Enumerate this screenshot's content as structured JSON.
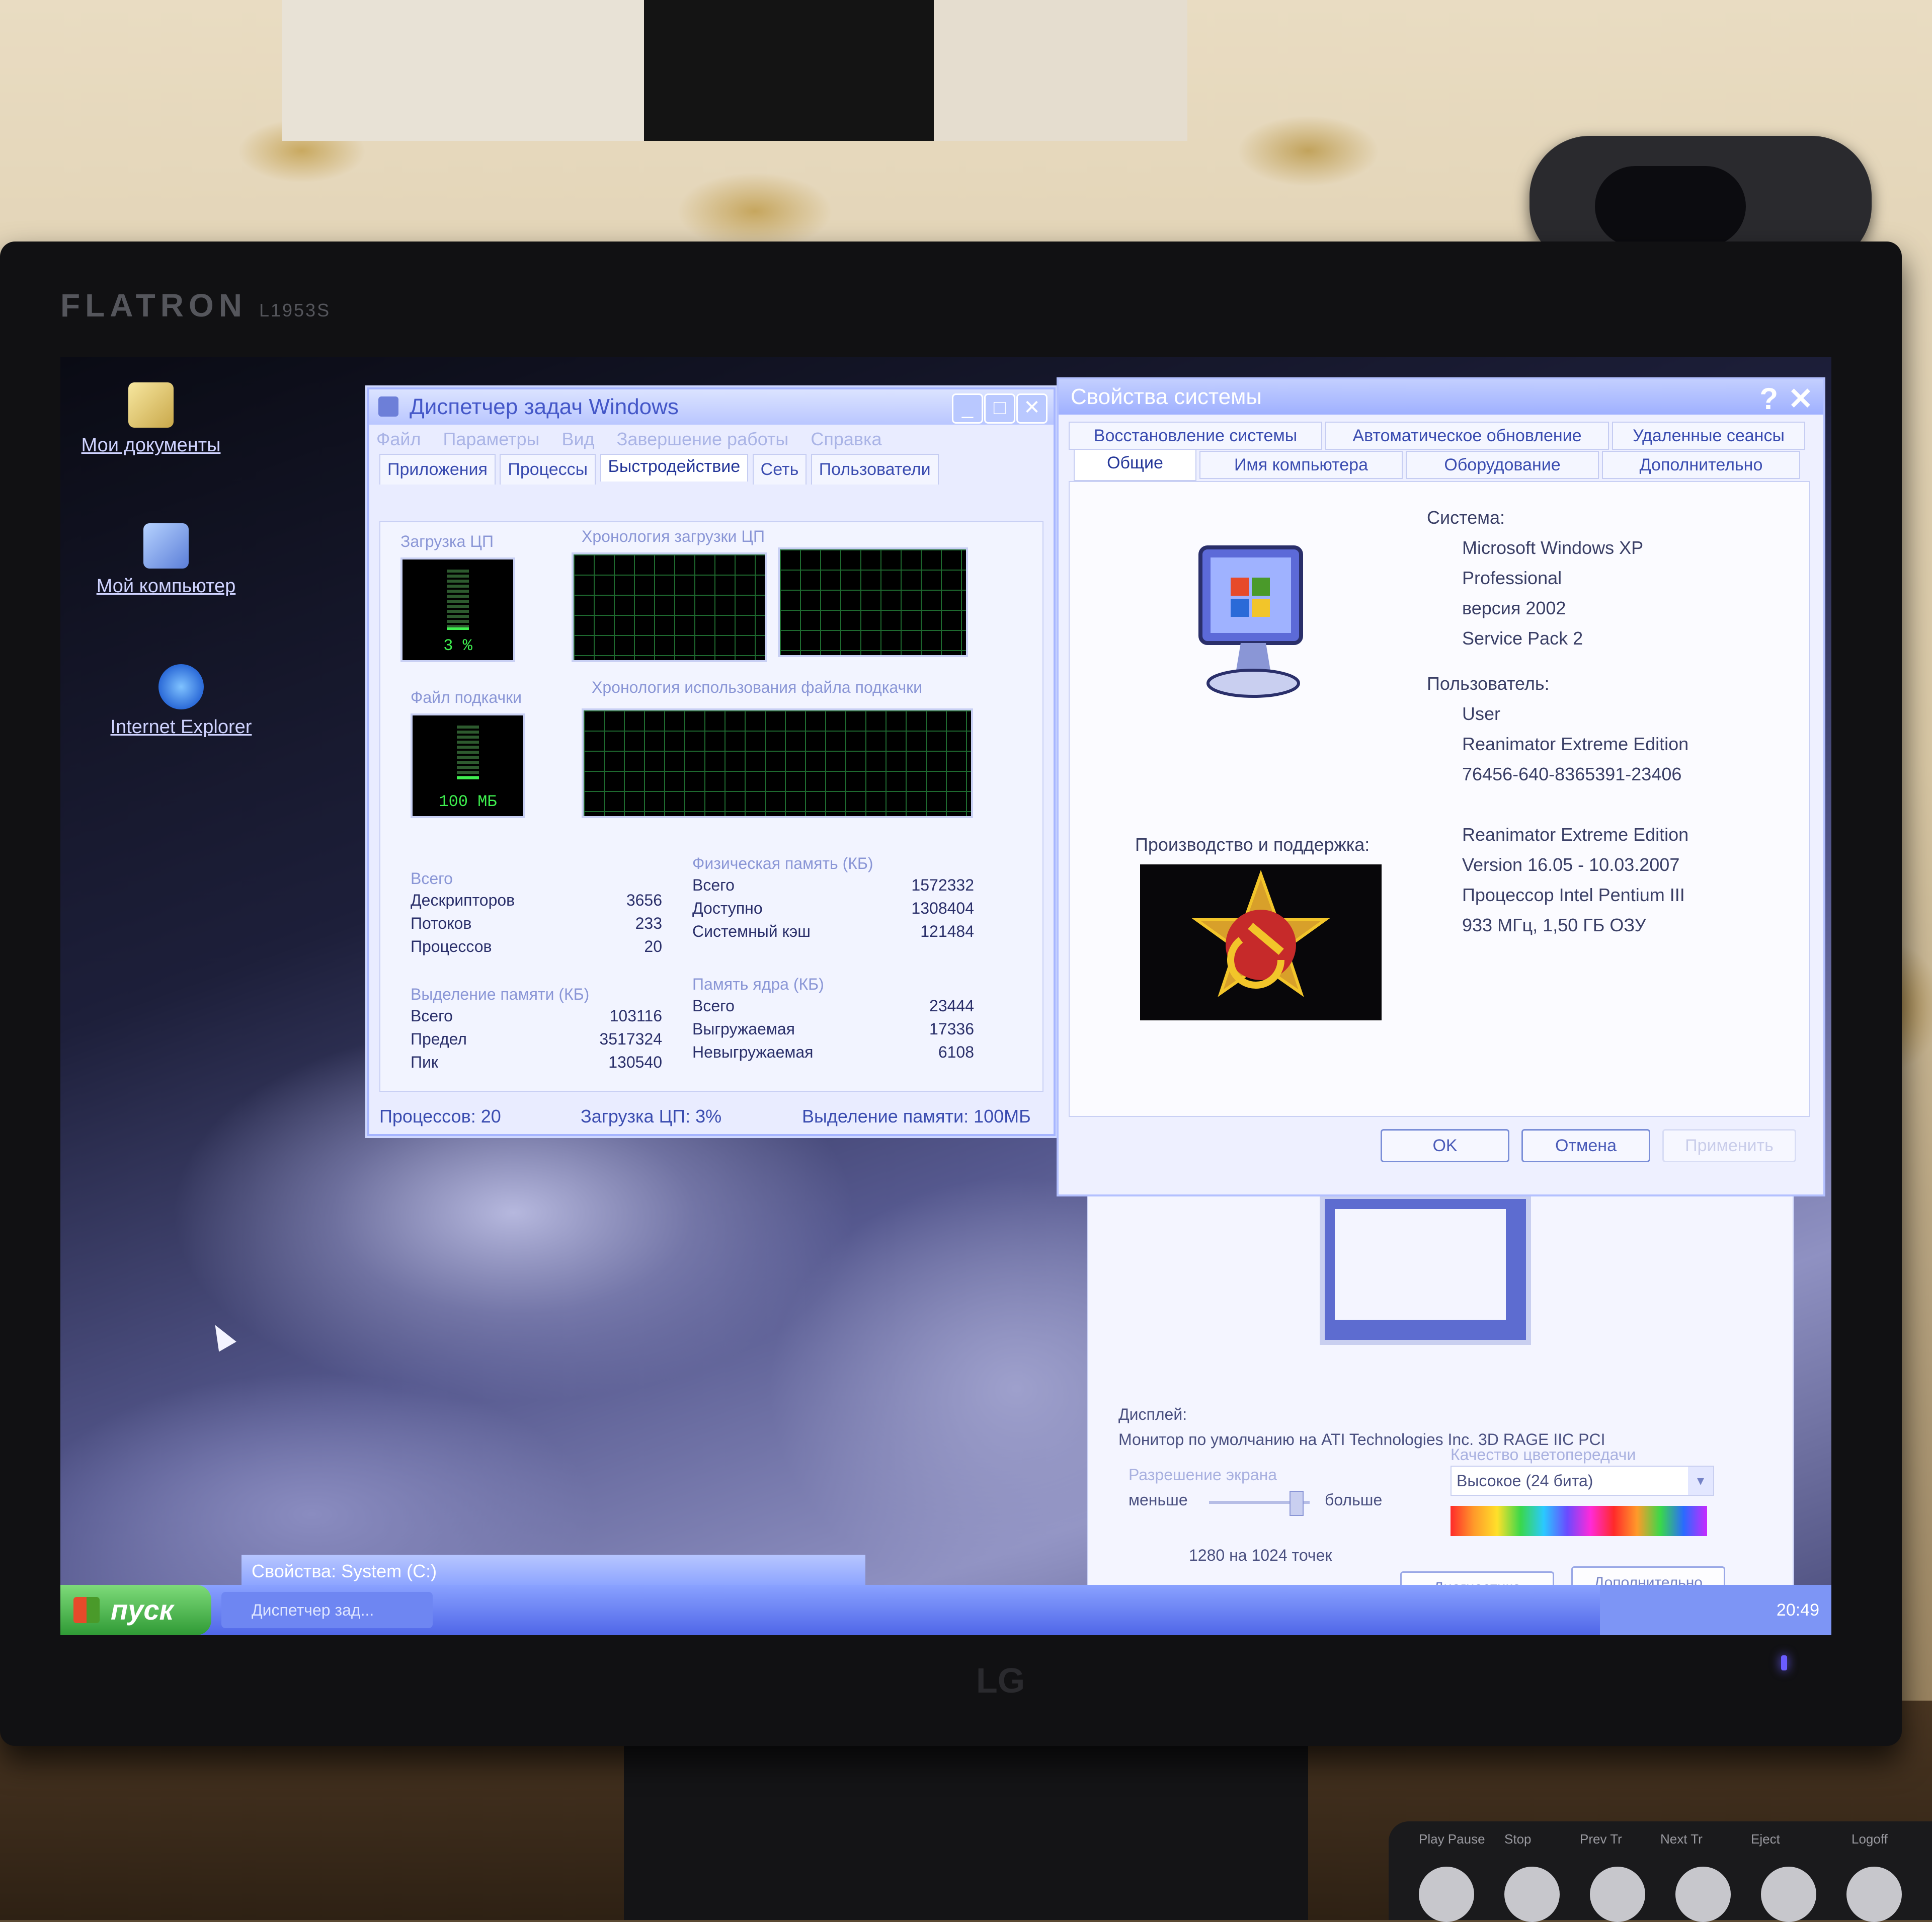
{
  "monitor": {
    "brand": "FLATRON",
    "model": "L1953S",
    "maker": "LG"
  },
  "desktop": {
    "icons": [
      {
        "label": "Мои документы"
      },
      {
        "label": "Мой компьютер"
      },
      {
        "label": "Internet Explorer"
      }
    ]
  },
  "task_manager": {
    "title": "Диспетчер задач Windows",
    "menu": [
      "Файл",
      "Параметры",
      "Вид",
      "Завершение работы",
      "Справка"
    ],
    "tabs": [
      "Приложения",
      "Процессы",
      "Быстродействие",
      "Сеть",
      "Пользователи"
    ],
    "active_tab": "Быстродействие",
    "cpu_label": "Загрузка ЦП",
    "cpu_history_label": "Хронология загрузки ЦП",
    "cpu_value": "3 %",
    "cpu_fraction": 0.03,
    "pagefile_label": "Файл подкачки",
    "pagefile_history_label": "Хронология использования файла подкачки",
    "pagefile_value": "100 МБ",
    "totals": {
      "title": "Всего",
      "rows": [
        {
          "label": "Дескрипторов",
          "value": "3656"
        },
        {
          "label": "Потоков",
          "value": "233"
        },
        {
          "label": "Процессов",
          "value": "20"
        }
      ]
    },
    "physical": {
      "title": "Физическая память (КБ)",
      "rows": [
        {
          "label": "Всего",
          "value": "1572332"
        },
        {
          "label": "Доступно",
          "value": "1308404"
        },
        {
          "label": "Системный кэш",
          "value": "121484"
        }
      ]
    },
    "commit": {
      "title": "Выделение памяти (КБ)",
      "rows": [
        {
          "label": "Всего",
          "value": "103116"
        },
        {
          "label": "Предел",
          "value": "3517324"
        },
        {
          "label": "Пик",
          "value": "130540"
        }
      ]
    },
    "kernel": {
      "title": "Память ядра (КБ)",
      "rows": [
        {
          "label": "Всего",
          "value": "23444"
        },
        {
          "label": "Выгружаемая",
          "value": "17336"
        },
        {
          "label": "Невыгружаемая",
          "value": "6108"
        }
      ]
    },
    "status": {
      "processes": "Процессов: 20",
      "cpu": "Загрузка ЦП: 3%",
      "commit": "Выделение памяти: 100МБ"
    }
  },
  "system_properties": {
    "title": "Свойства системы",
    "tabs_row1": [
      "Восстановление системы",
      "Автоматическое обновление",
      "Удаленные сеансы"
    ],
    "tabs_row2": [
      "Общие",
      "Имя компьютера",
      "Оборудование",
      "Дополнительно"
    ],
    "active_tab": "Общие",
    "system_label": "Система:",
    "system_lines": [
      "Microsoft Windows XP",
      "Professional",
      "версия 2002",
      "Service Pack 2"
    ],
    "user_label": "Пользователь:",
    "user_lines": [
      "User",
      "Reanimator Extreme Edition",
      "76456-640-8365391-23406"
    ],
    "support_label": "Производство и поддержка:",
    "support_lines": [
      "Reanimator Extreme Edition",
      "Version 16.05 - 10.03.2007",
      "Процессор Intel Pentium III",
      "933 МГц, 1,50 ГБ ОЗУ"
    ],
    "buttons": {
      "ok": "OK",
      "cancel": "Отмена",
      "apply": "Применить"
    }
  },
  "display_properties": {
    "display_label": "Дисплей:",
    "display_value": "Монитор по умолчанию на ATI Technologies Inc. 3D RAGE IIC PCI",
    "resolution_label": "Разрешение экрана",
    "less": "меньше",
    "more": "больше",
    "resolution_value": "1280 на 1024 точек",
    "color_label": "Качество цветопередачи",
    "color_value": "Высокое (24 бита)",
    "buttons": {
      "diagnostics": "Диагностика",
      "advanced": "Дополнительно"
    }
  },
  "bottom_window": {
    "title": "Свойства: System (C:)"
  },
  "taskbar": {
    "start": "пуск",
    "task": "Диспетчер зад...",
    "clock": "20:49"
  },
  "remote_keys": [
    "Play Pause",
    "Stop",
    "Prev Tr",
    "Next Tr",
    "Eject",
    "Logoff"
  ]
}
